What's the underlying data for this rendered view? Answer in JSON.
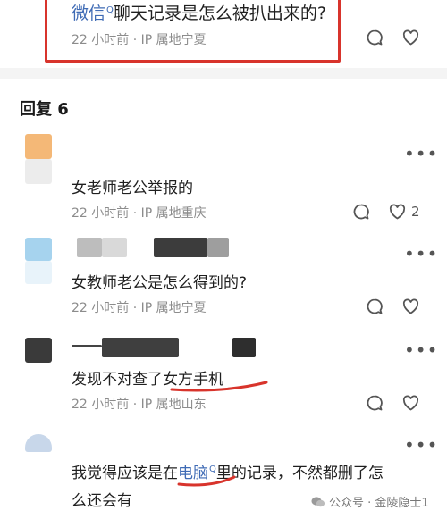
{
  "post": {
    "text_link": "微信",
    "text_rest": "聊天记录是怎么被扒出来的?",
    "time": "22 小时前",
    "location": "IP 属地宁夏"
  },
  "replies_header": "回复 6",
  "replies": [
    {
      "text": "女老师老公举报的",
      "time": "22 小时前",
      "location": "IP 属地重庆",
      "likes": "2"
    },
    {
      "text": "女教师老公是怎么得到的?",
      "time": "22 小时前",
      "location": "IP 属地宁夏"
    },
    {
      "text_a": "发现不对查了",
      "text_b": "女方手机",
      "time": "22 小时前",
      "location": "IP 属地山东"
    },
    {
      "text_a": "我觉得应该是在",
      "text_link": "电脑",
      "text_b": "里的记录，不然都删了怎",
      "text_c": "么还会有"
    }
  ],
  "more_symbol": "•••",
  "watermark": "公众号 · 金陵隐士1",
  "colors": {
    "highlight_red": "#d8342c",
    "link_blue": "#3f6bb5",
    "meta_gray": "#8c8c8c"
  },
  "icons": [
    "comment-icon",
    "heart-icon",
    "more-icon",
    "wechat-icon"
  ]
}
